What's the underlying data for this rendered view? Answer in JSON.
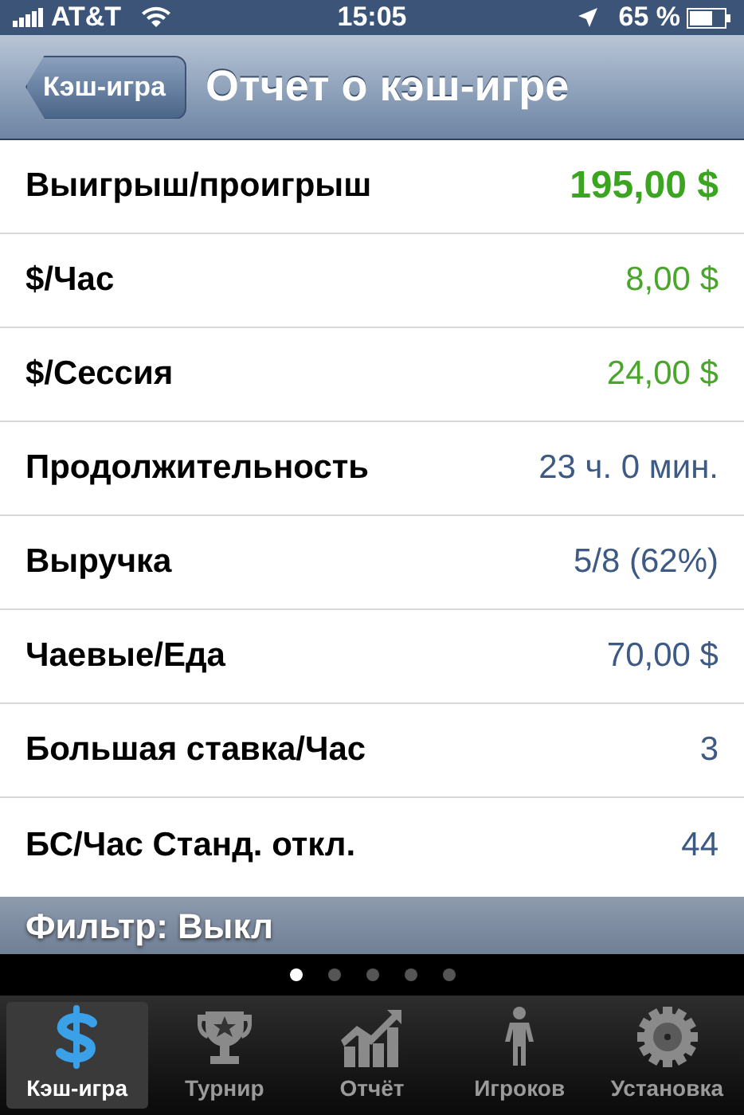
{
  "status_bar": {
    "carrier": "AT&T",
    "time": "15:05",
    "battery": "65 %"
  },
  "nav": {
    "back": "Кэш-игра",
    "title": "Отчет о кэш-игре"
  },
  "rows": [
    {
      "label": "Выигрыш/проигрыш",
      "value": "195,00 $",
      "color": "#3aa51f",
      "emphasis": true
    },
    {
      "label": "$/Час",
      "value": "8,00 $",
      "color": "#4aa62a",
      "emphasis": false
    },
    {
      "label": "$/Сессия",
      "value": "24,00 $",
      "color": "#4aa62a",
      "emphasis": false
    },
    {
      "label": "Продолжительность",
      "value": "23 ч. 0 мин.",
      "color": "#3d5a85",
      "emphasis": false
    },
    {
      "label": "Выручка",
      "value": "5/8 (62%)",
      "color": "#3d5a85",
      "emphasis": false
    },
    {
      "label": "Чаевые/Еда",
      "value": "70,00 $",
      "color": "#3d5a85",
      "emphasis": false
    },
    {
      "label": "Большая ставка/Час",
      "value": "3",
      "color": "#3d5a85",
      "emphasis": false
    },
    {
      "label": "БС/Час Станд. откл.",
      "value": "44",
      "color": "#3d5a85",
      "emphasis": false
    }
  ],
  "filter": "Фильтр: Выкл",
  "page_dots": [
    {
      "selected": true
    },
    {
      "selected": false
    },
    {
      "selected": false
    },
    {
      "selected": false
    },
    {
      "selected": false
    }
  ],
  "tabs": [
    {
      "label": "Кэш-игра",
      "kind": "dollar",
      "selected": true
    },
    {
      "label": "Турнир",
      "kind": "trophy",
      "selected": false
    },
    {
      "label": "Отчёт",
      "kind": "chart",
      "selected": false
    },
    {
      "label": "Игроков",
      "kind": "person",
      "selected": false
    },
    {
      "label": "Установка",
      "kind": "gear",
      "selected": false
    }
  ]
}
